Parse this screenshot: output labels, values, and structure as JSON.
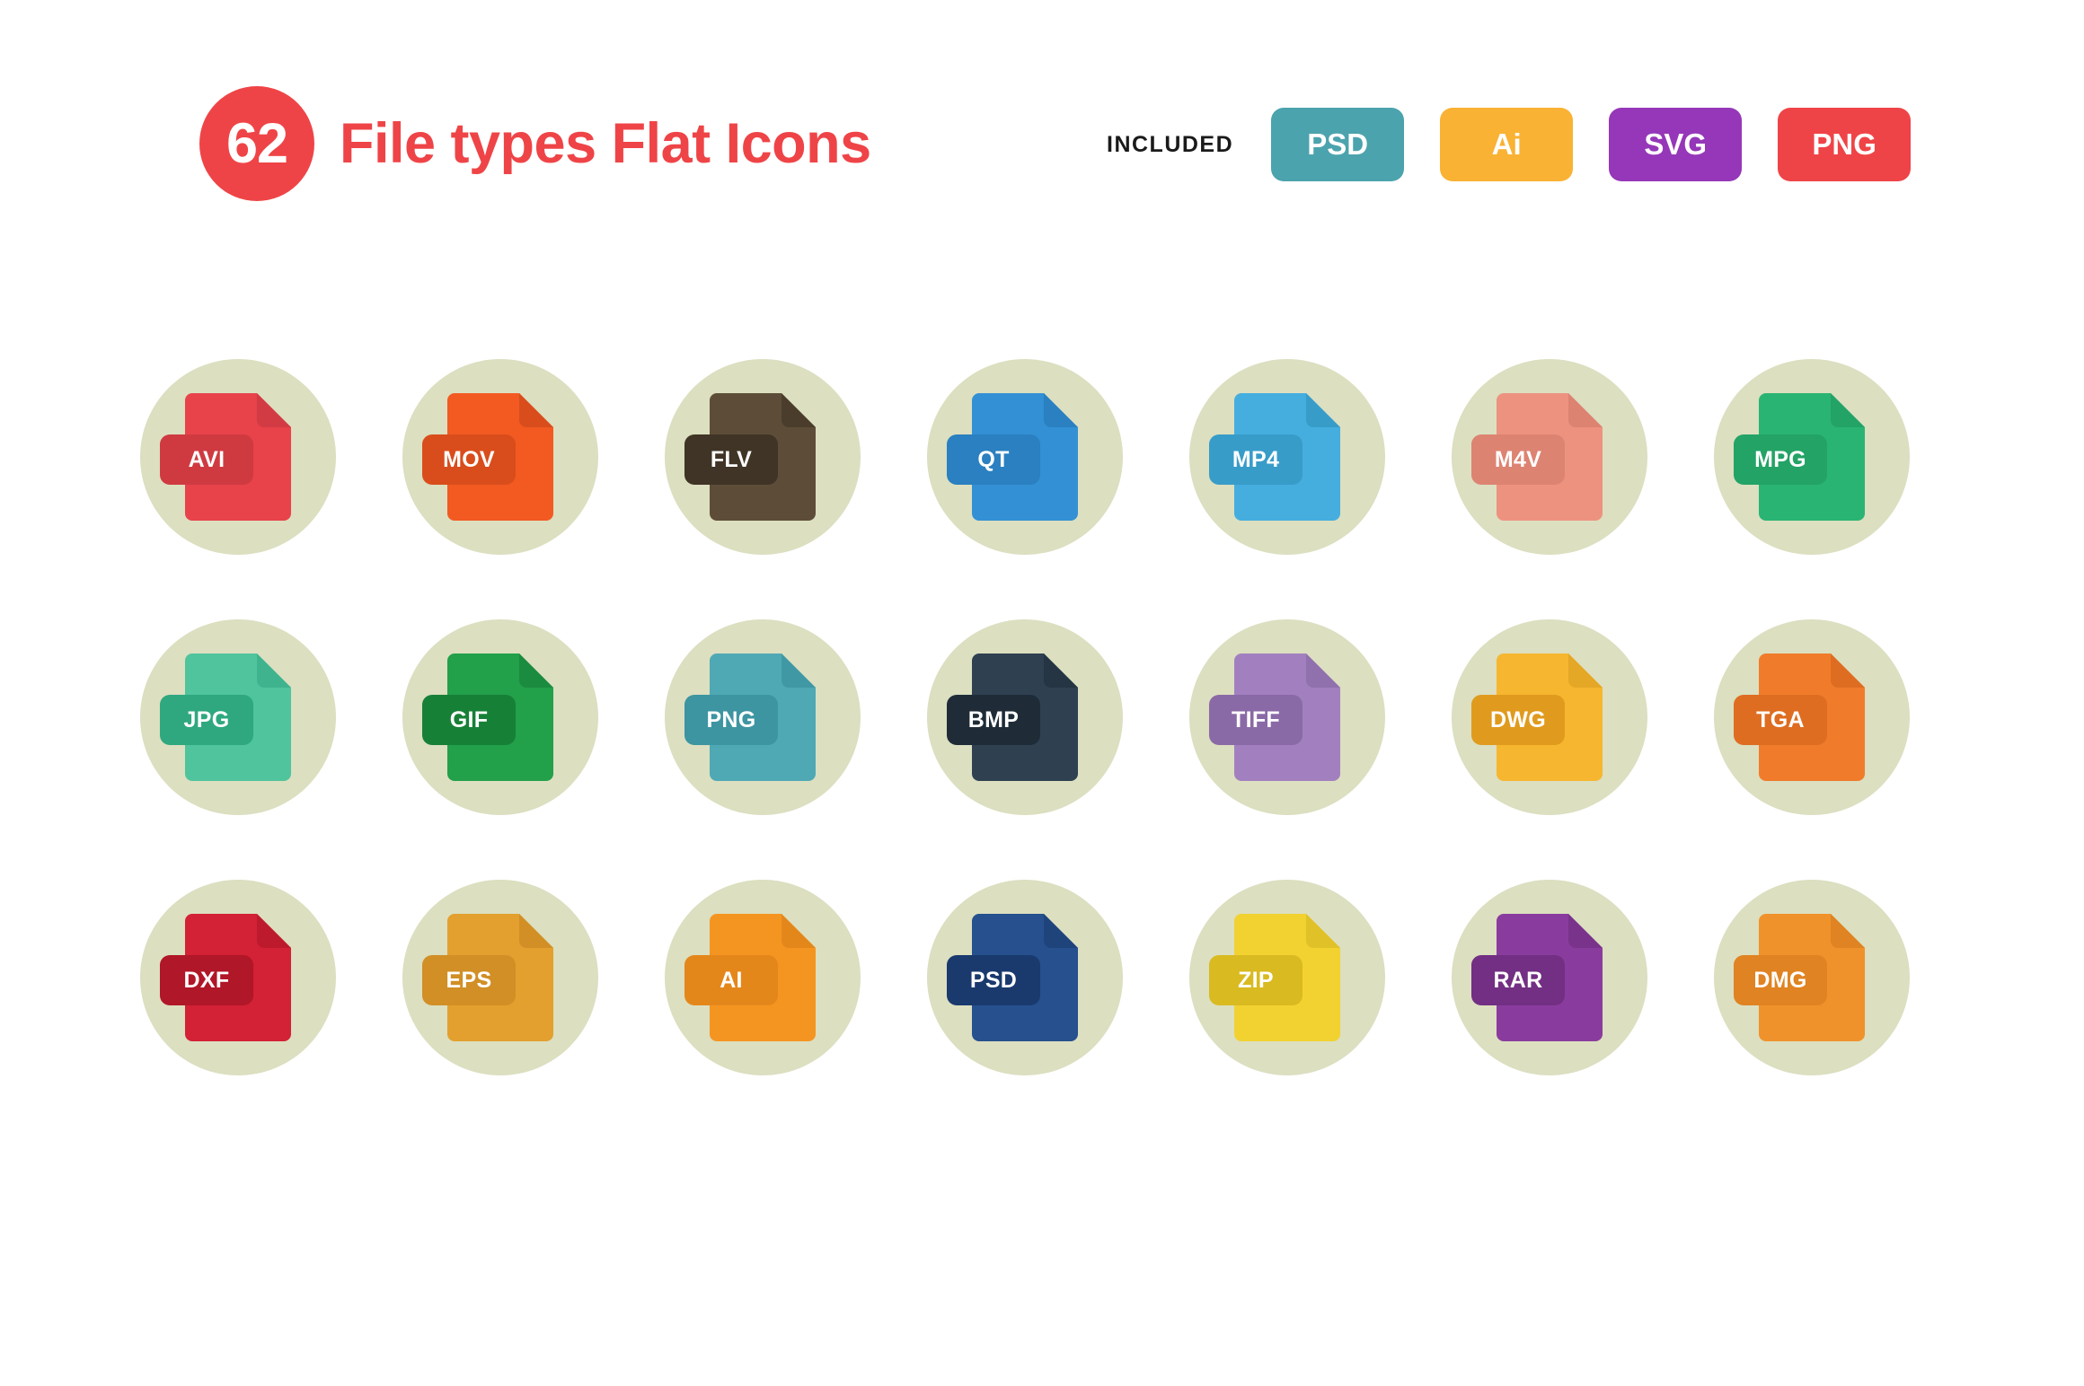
{
  "header": {
    "count": "62",
    "title": "File types Flat Icons",
    "included_label": "INCLUDED",
    "badge_red": "#ef4447",
    "formats": [
      {
        "label": "PSD",
        "color": "#4ba3ad"
      },
      {
        "label": "Ai",
        "color": "#f9b233"
      },
      {
        "label": "SVG",
        "color": "#9537b8"
      },
      {
        "label": "PNG",
        "color": "#ef4447"
      }
    ]
  },
  "grid": {
    "circle_color": "#dcdfc0",
    "columns": 7,
    "rows": 3,
    "icons": [
      {
        "label": "AVI",
        "doc": "#e8424a",
        "fold": "#d23b44",
        "tab": "#cf3a41"
      },
      {
        "label": "MOV",
        "doc": "#f25a22",
        "fold": "#d94d1c",
        "tab": "#d94d1c"
      },
      {
        "label": "FLV",
        "doc": "#5d4d38",
        "fold": "#4a3d2c",
        "tab": "#3f3425"
      },
      {
        "label": "QT",
        "doc": "#3390d5",
        "fold": "#2a80c0",
        "tab": "#2a80c0"
      },
      {
        "label": "MP4",
        "doc": "#45aede",
        "fold": "#389cc9",
        "tab": "#389cc9"
      },
      {
        "label": "M4V",
        "doc": "#ee9280",
        "fold": "#dd8372",
        "tab": "#dd8372"
      },
      {
        "label": "MPG",
        "doc": "#2ab473",
        "fold": "#23a366",
        "tab": "#23a366"
      },
      {
        "label": "JPG",
        "doc": "#4fc49d",
        "fold": "#3fb38d",
        "tab": "#2fa87f"
      },
      {
        "label": "GIF",
        "doc": "#22a04a",
        "fold": "#1b8b3f",
        "tab": "#178037"
      },
      {
        "label": "PNG",
        "doc": "#4fa9b5",
        "fold": "#4098a4",
        "tab": "#3d95a1"
      },
      {
        "label": "BMP",
        "doc": "#2f4151",
        "fold": "#253543",
        "tab": "#1f2c38"
      },
      {
        "label": "TIFF",
        "doc": "#a280bf",
        "fold": "#9070ad",
        "tab": "#8a6aa6"
      },
      {
        "label": "DWG",
        "doc": "#f6b62f",
        "fold": "#e5a726",
        "tab": "#e09b1e"
      },
      {
        "label": "TGA",
        "doc": "#f07c2b",
        "fold": "#de6d22",
        "tab": "#de6d22"
      },
      {
        "label": "DXF",
        "doc": "#d32135",
        "fold": "#bd1b2d",
        "tab": "#b01728"
      },
      {
        "label": "EPS",
        "doc": "#e3a02e",
        "fold": "#d18f26",
        "tab": "#d18f26"
      },
      {
        "label": "AI",
        "doc": "#f59521",
        "fold": "#e4871b",
        "tab": "#e4871b"
      },
      {
        "label": "PSD",
        "doc": "#26508e",
        "fold": "#1f447c",
        "tab": "#1a3a6e"
      },
      {
        "label": "ZIP",
        "doc": "#f2d231",
        "fold": "#e0c128",
        "tab": "#d9ba20"
      },
      {
        "label": "RAR",
        "doc": "#8a3c9e",
        "fold": "#79338b",
        "tab": "#722f83"
      },
      {
        "label": "DMG",
        "doc": "#f0922b",
        "fold": "#e08322",
        "tab": "#e08322"
      }
    ]
  }
}
